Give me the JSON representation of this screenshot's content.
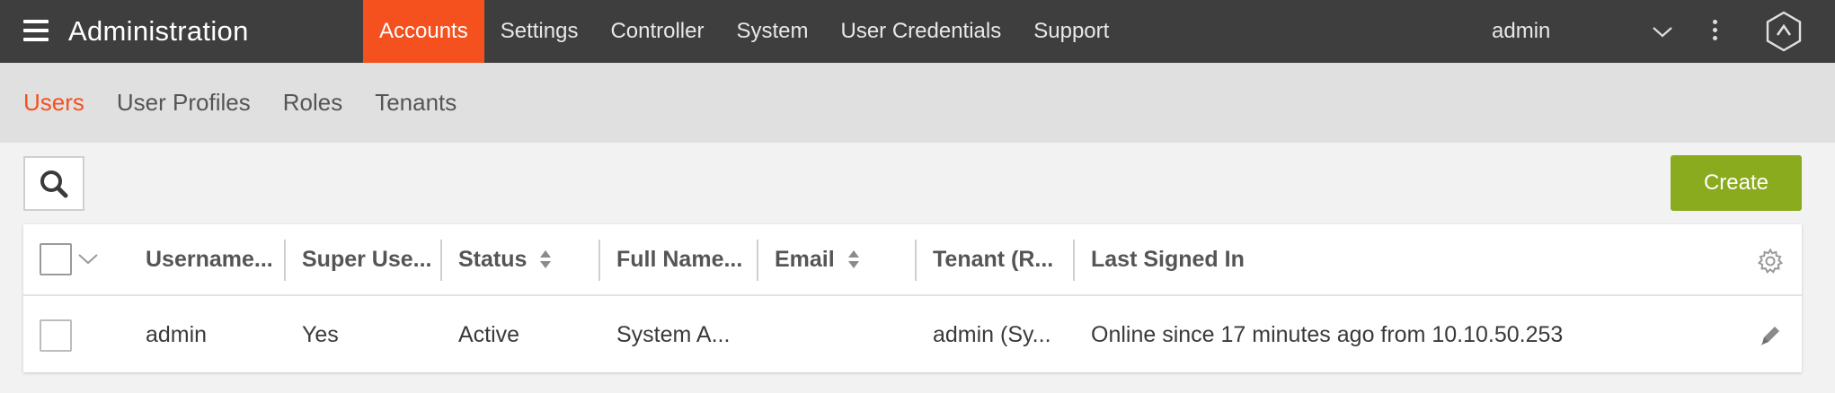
{
  "header": {
    "app_title": "Administration",
    "nav": [
      "Accounts",
      "Settings",
      "Controller",
      "System",
      "User Credentials",
      "Support"
    ],
    "active_nav": "Accounts",
    "user": "admin",
    "accent": "#f4511e",
    "bar_color": "#3e3e3e"
  },
  "subnav": {
    "items": [
      "Users",
      "User Profiles",
      "Roles",
      "Tenants"
    ],
    "active": "Users"
  },
  "toolbar": {
    "search_icon": "search-icon",
    "create_label": "Create",
    "create_color": "#8aab1e"
  },
  "table": {
    "columns": [
      "Username...",
      "Super Use...",
      "Status",
      "Full Name...",
      "Email",
      "Tenant (R...",
      "Last Signed In"
    ],
    "sortable": [
      "Status",
      "Email"
    ],
    "rows": [
      {
        "username": "admin",
        "super_user": "Yes",
        "status": "Active",
        "full_name": "System A...",
        "email": "",
        "tenant": "admin (Sy...",
        "last_signed_in": "Online since 17 minutes ago from 10.10.50.253"
      }
    ]
  }
}
